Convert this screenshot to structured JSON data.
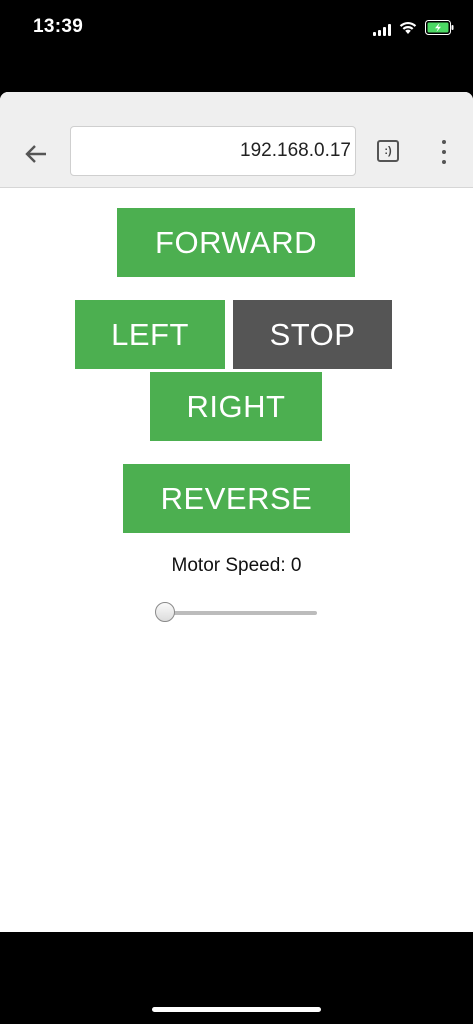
{
  "status_bar": {
    "time": "13:39",
    "icons": [
      "cellular-signal-icon",
      "wifi-icon",
      "battery-charging-icon"
    ],
    "battery_color": "#4cd964"
  },
  "browser": {
    "url": "192.168.0.17",
    "tab_switcher_label": ":)",
    "icons": [
      "back-arrow-icon",
      "tab-switcher-icon",
      "more-vert-icon"
    ]
  },
  "controls": {
    "forward_label": "FORWARD",
    "left_label": "LEFT",
    "stop_label": "STOP",
    "right_label": "RIGHT",
    "reverse_label": "REVERSE",
    "button_color": "#4caf50",
    "stop_color": "#555555"
  },
  "speed": {
    "label": "Motor Speed: 0",
    "value": 0,
    "min": 0,
    "max": 100
  }
}
